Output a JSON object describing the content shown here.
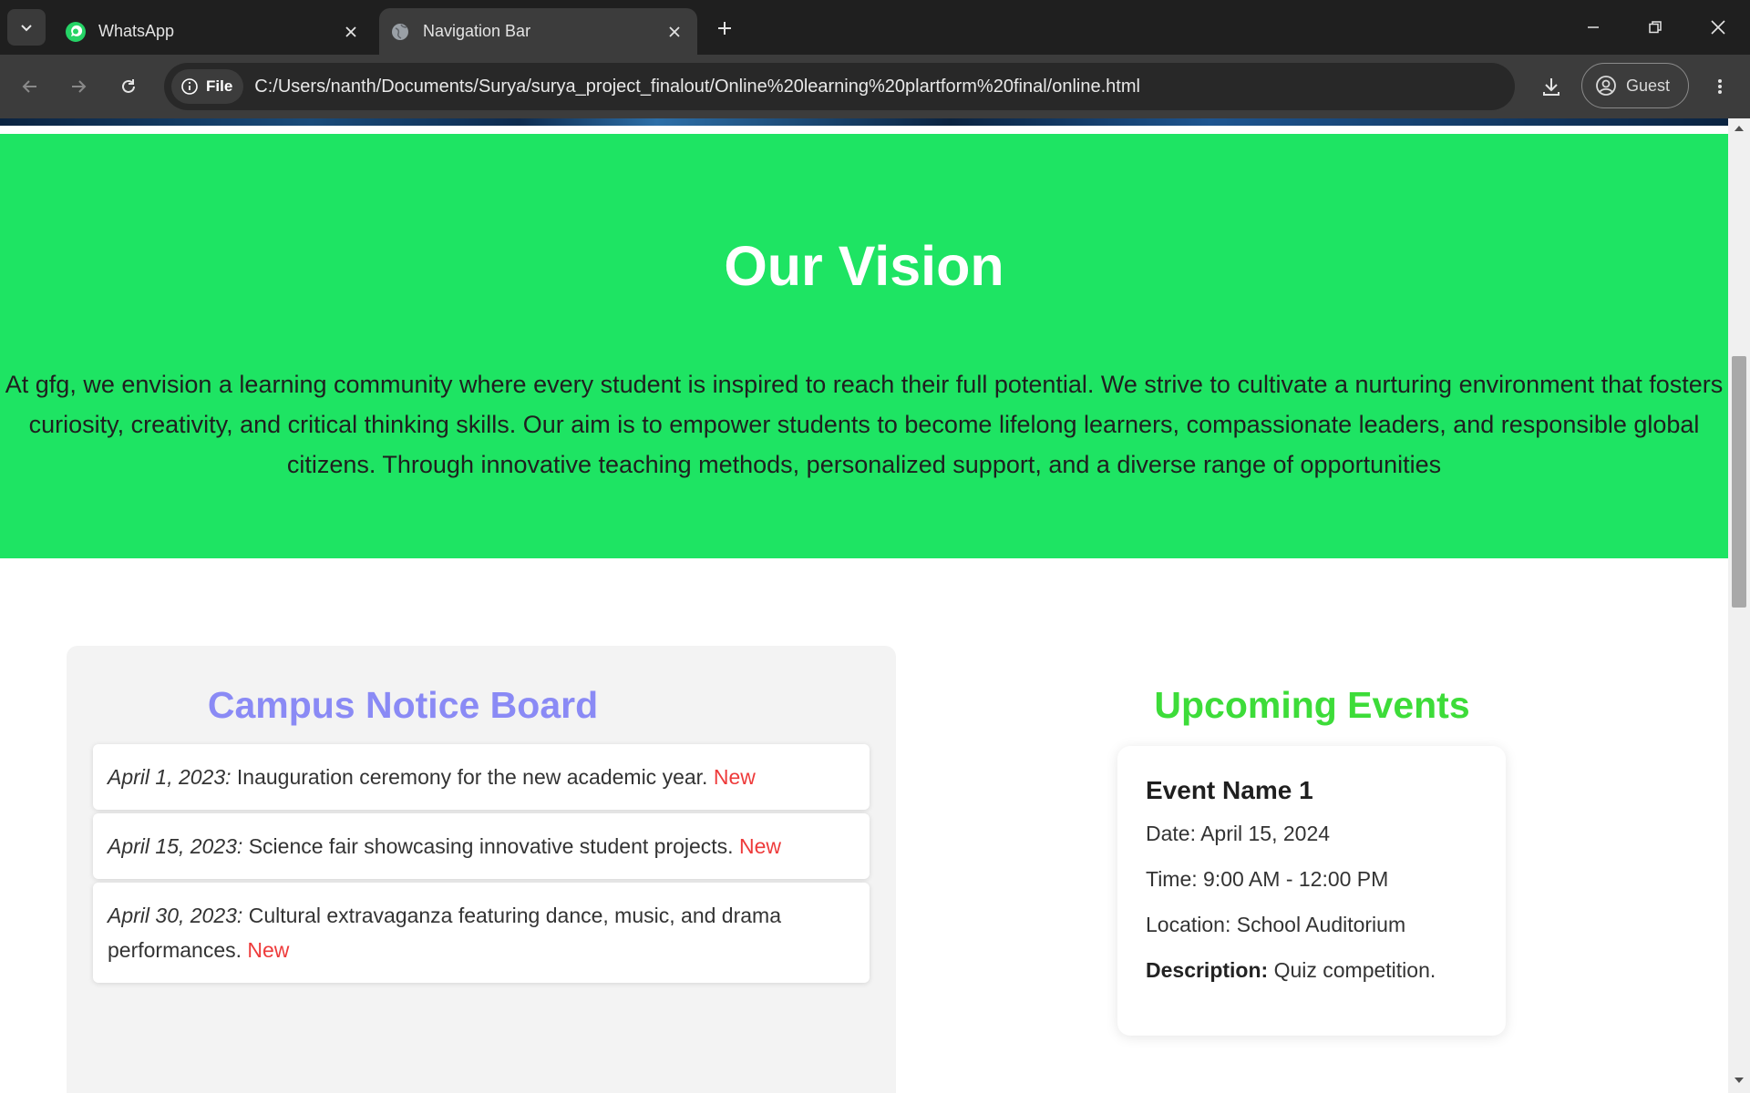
{
  "browser": {
    "tabs": [
      {
        "title": "WhatsApp",
        "icon": "whatsapp-icon",
        "active": false
      },
      {
        "title": "Navigation Bar",
        "icon": "globe-icon",
        "active": true
      }
    ],
    "address": {
      "scheme_chip": "File",
      "url": "C:/Users/nanth/Documents/Surya/surya_project_finalout/Online%20learning%20plartform%20final/online.html"
    },
    "profile_label": "Guest"
  },
  "vision": {
    "title": "Our Vision",
    "text": "At gfg, we envision a learning community where every student is inspired to reach their full potential. We strive to cultivate a nurturing environment that fosters curiosity, creativity, and critical thinking skills. Our aim is to empower students to become lifelong learners, compassionate leaders, and responsible global citizens. Through innovative teaching methods, personalized support, and a diverse range of opportunities",
    "background_color": "#1ee463"
  },
  "notice_board": {
    "title": "Campus Notice Board",
    "title_color": "#8a8af5",
    "items": [
      {
        "date": "April 1, 2023:",
        "text": " Inauguration ceremony for the new academic year. ",
        "badge": "New"
      },
      {
        "date": "April 15, 2023:",
        "text": " Science fair showcasing innovative student projects. ",
        "badge": "New"
      },
      {
        "date": "April 30, 2023:",
        "text": " Cultural extravaganza featuring dance, music, and drama performances. ",
        "badge": "New"
      }
    ]
  },
  "events": {
    "title": "Upcoming Events",
    "title_color": "#3ddc39",
    "cards": [
      {
        "name": "Event Name 1",
        "date": "Date: April 15, 2024",
        "time": "Time: 9:00 AM - 12:00 PM",
        "location": "Location: School Auditorium",
        "description_label": "Description:",
        "description": " Quiz competition."
      }
    ]
  }
}
